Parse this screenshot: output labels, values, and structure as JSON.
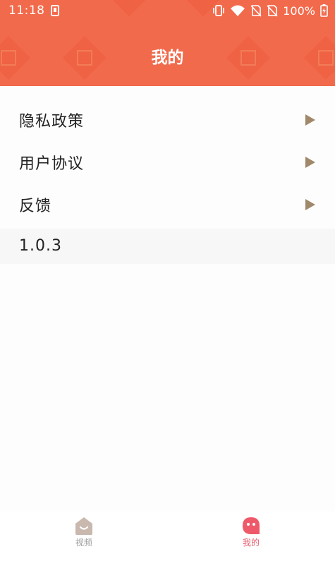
{
  "status_bar": {
    "time": "11:18",
    "battery": "100%",
    "icons": [
      "notification-icon",
      "vibrate-icon",
      "wifi-icon",
      "no-sim-icon",
      "no-sim-icon",
      "battery-charging-icon"
    ]
  },
  "header": {
    "title": "我的",
    "background_color": "#f26a4c"
  },
  "menu": {
    "items": [
      {
        "label": "隐私政策",
        "icon": "chevron-right-icon"
      },
      {
        "label": "用户协议",
        "icon": "chevron-right-icon"
      },
      {
        "label": "反馈",
        "icon": "chevron-right-icon"
      }
    ],
    "version": "1.0.3"
  },
  "bottom_nav": {
    "tabs": [
      {
        "label": "视频",
        "icon": "video-tab-icon",
        "active": false
      },
      {
        "label": "我的",
        "icon": "mine-tab-icon",
        "active": true
      }
    ],
    "active_color": "#e65a6a",
    "inactive_color": "#9a9a9a"
  }
}
